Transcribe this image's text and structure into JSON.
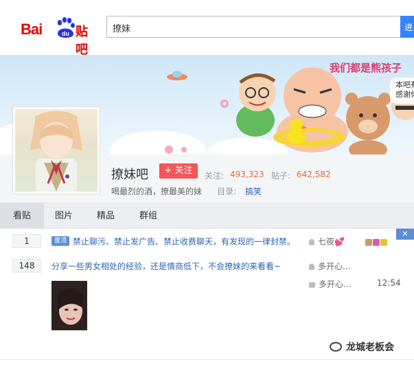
{
  "header": {
    "logo_text_bai": "Bai",
    "logo_text_du": "du",
    "logo_text_tieba": "贴吧",
    "search_value": "撩妹",
    "search_button_label": "进"
  },
  "banner": {
    "slogan": "我们都是熊孩子",
    "note": "本吧有\n感谢你"
  },
  "forum": {
    "name": "撩妹吧",
    "follow_label": "+ 关注",
    "follow_count_label": "关注:",
    "follow_count": "493,323",
    "post_count_label": "贴子:",
    "post_count": "642,582",
    "slogan": "喝最烈的酒，撩最美的妹",
    "directory_label": "目录:",
    "directory_value": "搞笑"
  },
  "tabs": [
    "看贴",
    "图片",
    "精品",
    "群组"
  ],
  "threads": [
    {
      "reply_count": "1",
      "badge": "置顶",
      "title": "禁止聊污、禁止发广告、禁止收费聊天，有发现的一律封禁。",
      "author": "七夜💕"
    },
    {
      "reply_count": "148",
      "title": "分享一些男女相处的经验，还是情商低下，不会撩妹的来看看~",
      "author": "多开心…",
      "last_reply_author": "多开心…",
      "time": "12:54"
    }
  ],
  "watermark": "龙城老板会",
  "colors": {
    "brand_red": "#e10601",
    "link_blue": "#2d64b3",
    "follow_red": "#f2555a",
    "stat_orange": "#e46a33"
  }
}
